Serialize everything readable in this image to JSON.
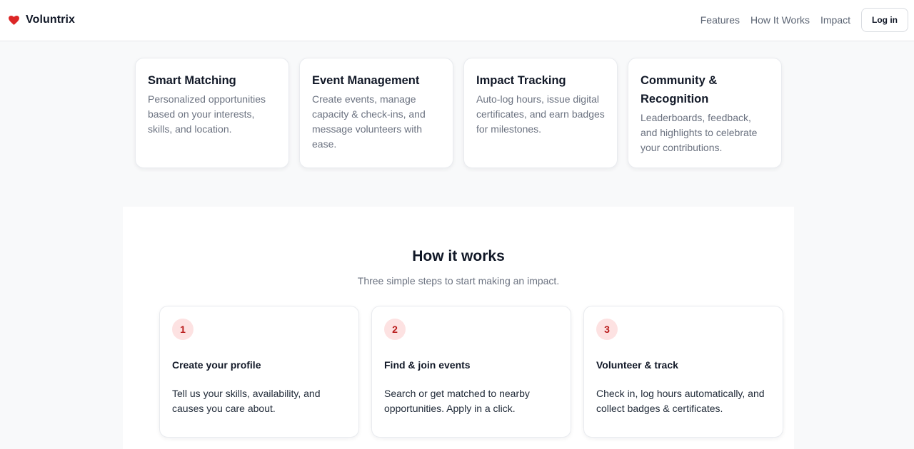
{
  "nav": {
    "brand": "Voluntrix",
    "links": [
      "Features",
      "How It Works",
      "Impact"
    ],
    "login_label": "Log in"
  },
  "features": [
    {
      "title": "Smart Matching",
      "desc": "Personalized opportunities based on your interests, skills, and location."
    },
    {
      "title": "Event Management",
      "desc": "Create events, manage capacity & check-ins, and message volunteers with ease."
    },
    {
      "title": "Impact Tracking",
      "desc": "Auto-log hours, issue digital certificates, and earn badges for milestones."
    },
    {
      "title": "Community & Recognition",
      "desc": "Leaderboards, feedback, and highlights to celebrate your contributions."
    }
  ],
  "how": {
    "title": "How it works",
    "subtitle": "Three simple steps to start making an impact.",
    "steps": [
      {
        "num": "1",
        "title": "Create your profile",
        "desc": "Tell us your skills, availability, and causes you care about."
      },
      {
        "num": "2",
        "title": "Find & join events",
        "desc": "Search or get matched to nearby opportunities. Apply in a click."
      },
      {
        "num": "3",
        "title": "Volunteer & track",
        "desc": "Check in, log hours automatically, and collect badges & certificates."
      }
    ]
  },
  "colors": {
    "accent": "#dc2626",
    "step_badge_bg": "#fde2e2",
    "page_bg": "#f8f9fa"
  },
  "icons": {
    "brand_icon": "heart-icon"
  }
}
